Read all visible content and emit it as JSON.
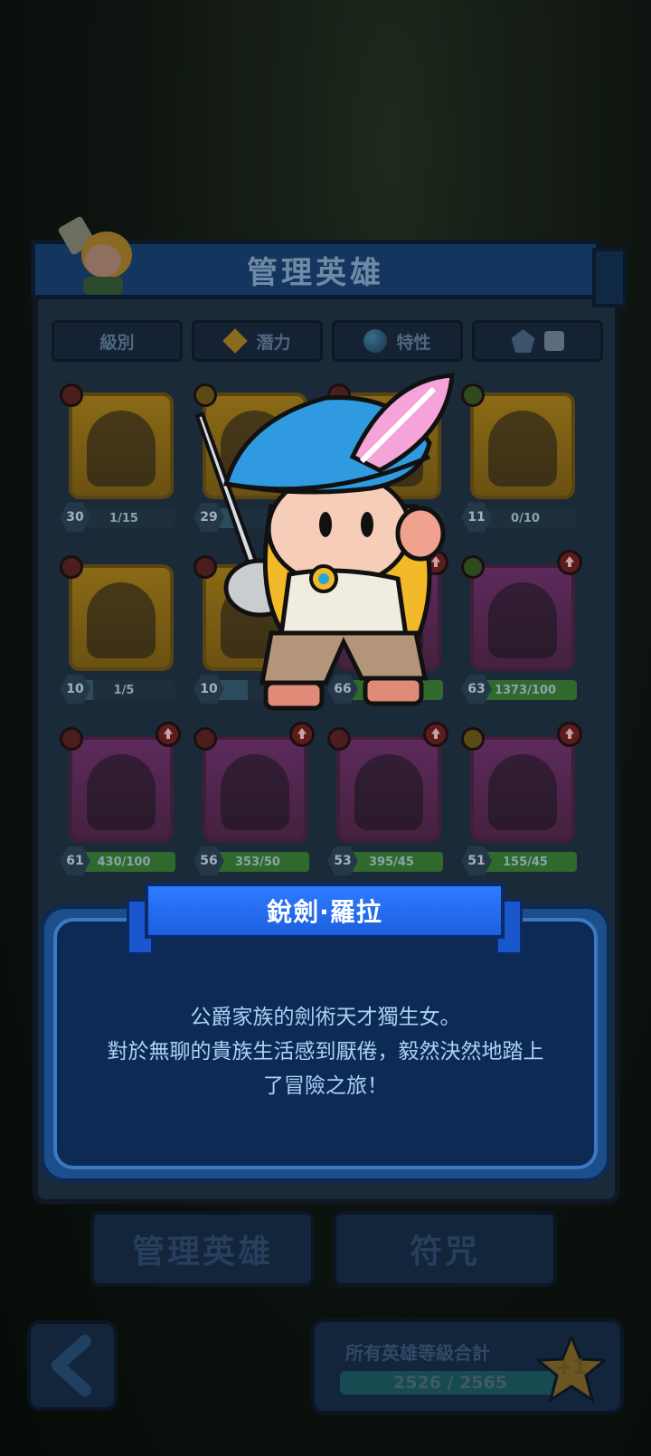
{
  "screen": {
    "title": "管理英雄"
  },
  "filters": [
    {
      "label": "級別",
      "icon": "none"
    },
    {
      "label": "潛力",
      "icon": "diamond-icon"
    },
    {
      "label": "特性",
      "icon": "orb-icon"
    },
    {
      "label": "",
      "icon": "gem-icon"
    }
  ],
  "heroes": [
    {
      "level": "30",
      "progress": "1/15",
      "fill": 0.07,
      "frame": "gold",
      "element": "red"
    },
    {
      "level": "29",
      "progress": "",
      "fill": 0.3,
      "frame": "gold",
      "element": "yellow"
    },
    {
      "level": "",
      "progress": "",
      "fill": 0.3,
      "frame": "gold",
      "element": "red"
    },
    {
      "level": "11",
      "progress": "0/10",
      "fill": 0.0,
      "frame": "gold",
      "element": "green"
    },
    {
      "level": "10",
      "progress": "1/5",
      "fill": 0.2,
      "frame": "gold",
      "element": "red"
    },
    {
      "level": "10",
      "progress": "",
      "fill": 0.4,
      "frame": "gold",
      "element": "red"
    },
    {
      "level": "66",
      "progress": "",
      "fill": 1.0,
      "frame": "purple",
      "element": "red"
    },
    {
      "level": "63",
      "progress": "1373/100",
      "fill": 1.0,
      "frame": "purple",
      "element": "green"
    },
    {
      "level": "61",
      "progress": "430/100",
      "fill": 1.0,
      "frame": "purple",
      "element": "red"
    },
    {
      "level": "56",
      "progress": "353/50",
      "fill": 1.0,
      "frame": "purple",
      "element": "red"
    },
    {
      "level": "53",
      "progress": "395/45",
      "fill": 1.0,
      "frame": "purple",
      "element": "red"
    },
    {
      "level": "51",
      "progress": "155/45",
      "fill": 1.0,
      "frame": "purple",
      "element": "yellow"
    }
  ],
  "hero_detail": {
    "name": "銳劍·羅拉",
    "description_line1": "公爵家族的劍術天才獨生女。",
    "description_line2": "對於無聊的貴族生活感到厭倦，毅然決然地踏上",
    "description_line3": "了冒險之旅！"
  },
  "tabs": {
    "manage": "管理英雄",
    "runes": "符咒"
  },
  "footer": {
    "total_label": "所有英雄等級合計",
    "total_value": "2526 / 2565",
    "total_fill": 0.985,
    "star_label": "+1"
  }
}
